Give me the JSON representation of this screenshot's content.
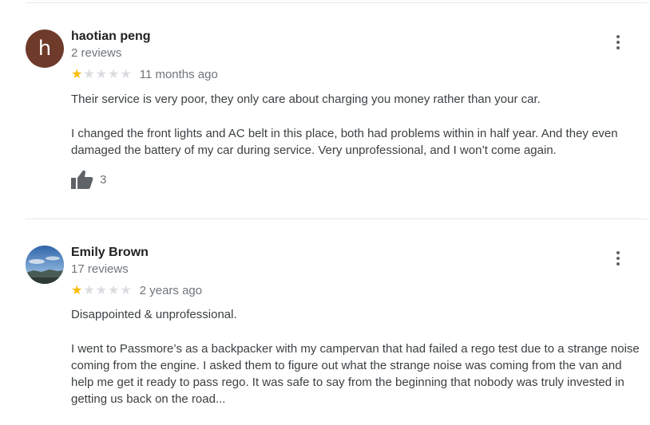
{
  "reviews": [
    {
      "avatar_letter": "h",
      "name": "haotian peng",
      "review_count": "2 reviews",
      "rating": 1,
      "time": "11 months ago",
      "paragraphs": [
        "Their service is very poor, they only care about charging you money rather than your car.",
        "I changed the front lights and AC belt in this place, both had problems within in half year. And they even damaged the battery of my car during service. Very unprofessional, and I won’t come again."
      ],
      "likes": "3"
    },
    {
      "name": "Emily Brown",
      "review_count": "17 reviews",
      "rating": 1,
      "time": "2 years ago",
      "paragraphs": [
        "Disappointed & unprofessional.",
        "I went to Passmore’s as a backpacker with my campervan that had failed a rego test due to a strange noise coming from the engine. I asked them to figure out what the strange noise was coming from the van and help me get it ready to pass rego. It was safe to say from the beginning that nobody was truly invested in getting us back on the road..."
      ]
    }
  ],
  "colors": {
    "star_filled": "#fbbc04",
    "star_empty": "#dadce0",
    "avatar_h": "#6e3b2b"
  },
  "icons": {
    "more": "more-vert-icon",
    "like": "thumbs-up-icon",
    "star": "star-icon"
  }
}
